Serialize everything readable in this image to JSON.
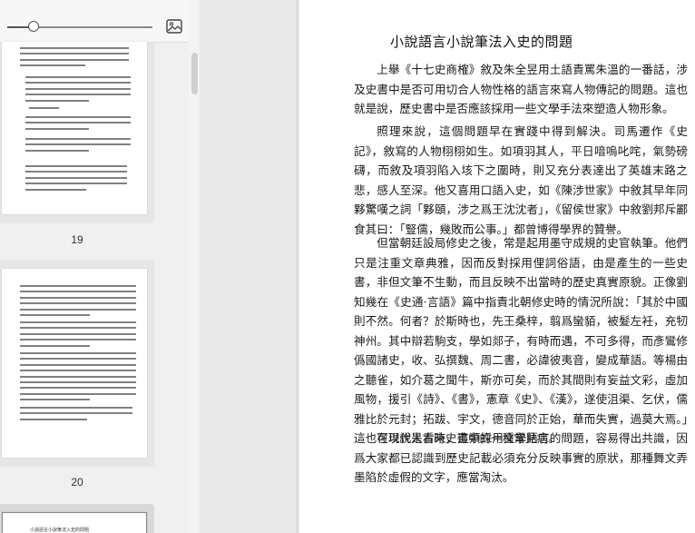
{
  "sidebar": {
    "zoom_percent": 18,
    "thumbnails": [
      {
        "label": "19"
      },
      {
        "label": "20"
      },
      {
        "label": "小說語言小說筆法入史的問題"
      }
    ]
  },
  "document": {
    "title": "小說語言小說筆法入史的問題",
    "paragraphs": [
      "上舉《十七史商榷》敘及朱全昱用土語責罵朱溫的一番話，涉及史書中是否可用切合人物性格的語言來寫人物傳記的問題。這也就是說，歷史書中是否應該採用一些文學手法來塑造人物形象。",
      "照理來說，這個問題早在實踐中得到解決。司馬遷作《史記》，敘寫的人物栩栩如生。如項羽其人，平日喑嗚叱咤，氣勢磅礴，而敘及項羽陷入垓下之圍時，則又充分表達出了英雄末路之悲，感人至深。他又喜用口語入史，如《陳涉世家》中敘其早年同夥驚嘆之詞「夥頤，涉之爲王沈沈者」，《留侯世家》中敘劉邦斥酈食其曰：「豎儒，幾敗而公事。」都曾博得學界的贊譽。",
      "但當朝廷設局修史之後，常是起用墨守成規的史官執筆。他們只是注重文章典雅，因而反對採用俚詞俗語，由是產生的一些史書，非但文筆不生動，而且反映不出當時的歷史真實原貌。正像劉知幾在《史通·言語》篇中指責北朝修史時的情況所說：「其於中國則不然。何者？於斯時也，先王桑梓，翦爲蠻貊，被髮左衽，充牣神州。其中辯若駒支，學如郯子，有時而遇，不可多得，而彥鸞修僞國諸史，收、弘撰魏、周二書，必諱彼夷音，變成華語。等楊由之聽雀，如介葛之聞牛，斯亦可矣，而於其間則有妄益文彩，虛加風物，援引《詩》、《書》，憲章《史》、《漢》，遂使沮渠、乞伏，儒雅比於元封；拓跋、宇文，德音同於正始，華而失實，過莫大焉。」這也可以說是古時史書中的一種常見病。",
      "在現代人看來，這類採用文學語言的問題，容易得出共識，因爲大家都已認識到歷史記載必須充分反映事實的原狀，那種舞文弄墨陷於虛假的文字，應當淘汰。"
    ]
  }
}
